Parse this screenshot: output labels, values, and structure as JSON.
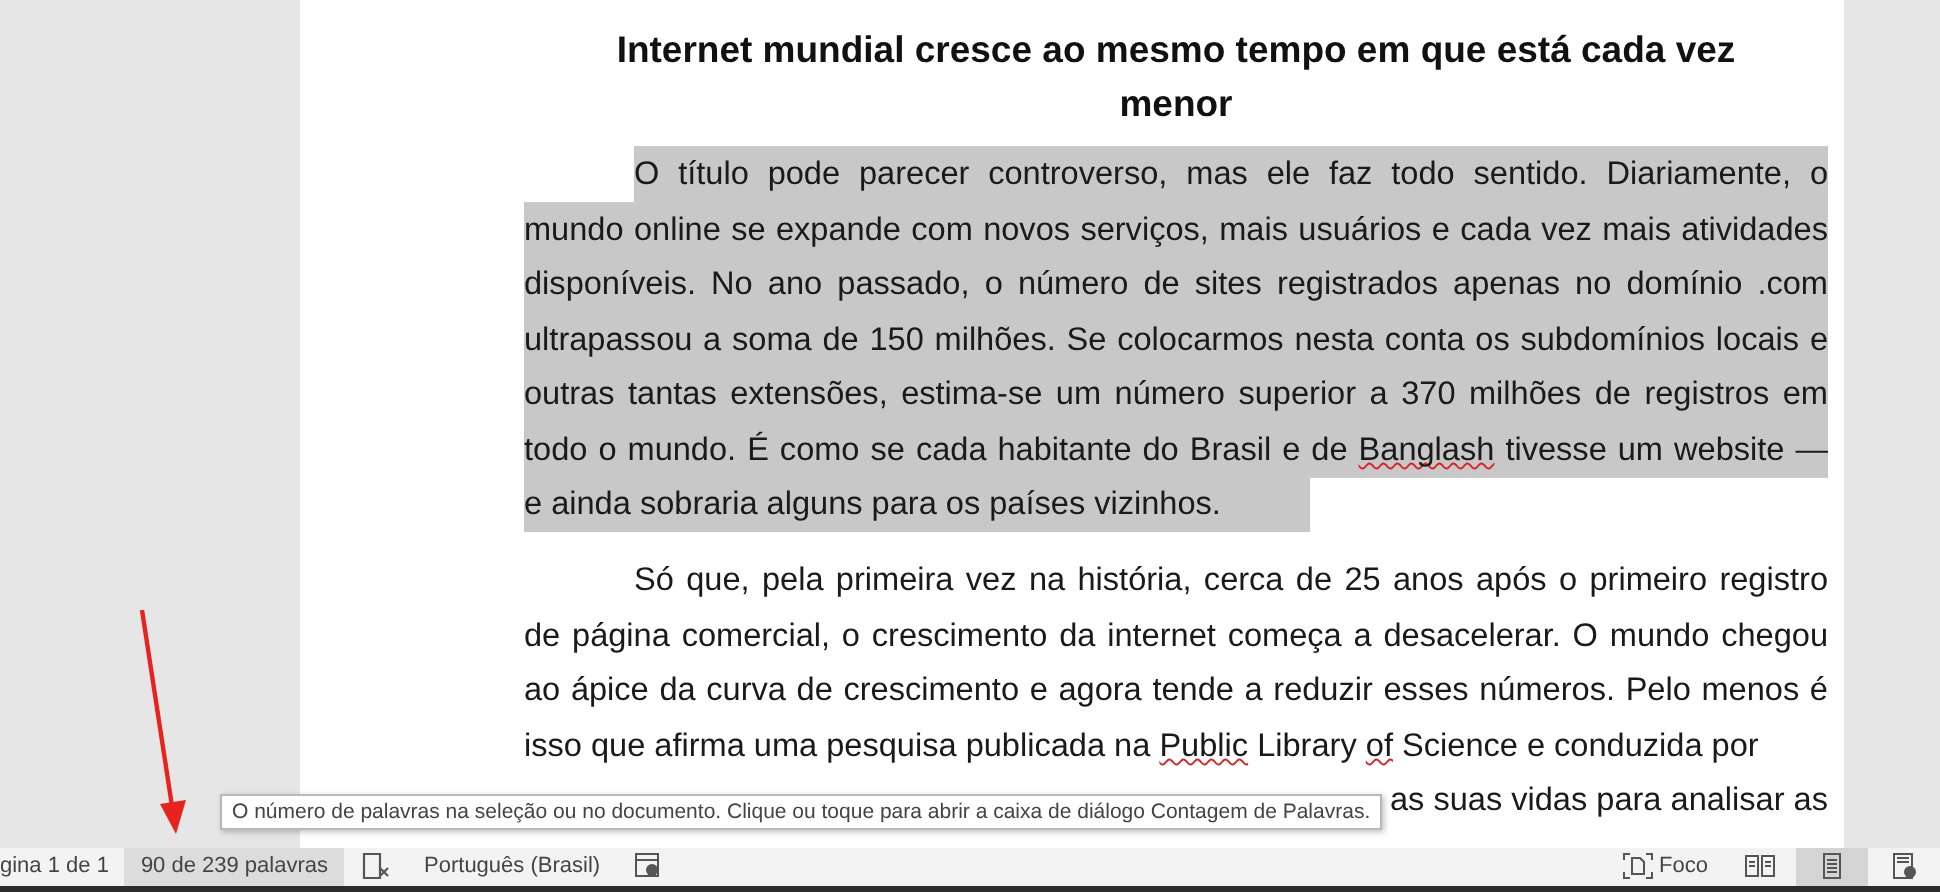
{
  "heading": "Internet mundial cresce ao mesmo tempo em que está cada vez menor",
  "paragraphs": [
    {
      "selected": true,
      "lines": [
        [
          {
            "text": "O título pode parecer controverso, mas ele faz todo sentido. Diariamente, o",
            "misspelled": false
          }
        ],
        [
          {
            "text": "mundo online se expande com novos serviços, mais usuários e cada vez mais atividades",
            "misspelled": false
          }
        ],
        [
          {
            "text": "disponíveis. No ano passado, o número de sites registrados apenas no domínio .com",
            "misspelled": false
          }
        ],
        [
          {
            "text": "ultrapassou a soma de 150 milhões. Se colocarmos nesta conta os subdomínios locais e",
            "misspelled": false
          }
        ],
        [
          {
            "text": "outras tantas extensões, estima-se um número superior a 370 milhões de registros em",
            "misspelled": false
          }
        ],
        [
          {
            "text": "todo o mundo. É como se cada habitante do Brasil e de",
            "misspelled": false
          },
          {
            "text": "Banglash",
            "misspelled": true
          },
          {
            "text": "tivesse um website —",
            "misspelled": false
          }
        ],
        [
          {
            "text": "e ainda sobraria alguns para os países vizinhos.",
            "misspelled": false
          }
        ]
      ]
    },
    {
      "selected": false,
      "lines": [
        [
          {
            "text": "Só que, pela primeira vez na história, cerca de 25 anos após o primeiro registro",
            "misspelled": false
          }
        ],
        [
          {
            "text": "de página comercial, o crescimento da internet começa a desacelerar. O mundo chegou",
            "misspelled": false
          }
        ],
        [
          {
            "text": "ao ápice da curva de crescimento e agora tende a reduzir esses números. Pelo menos é",
            "misspelled": false
          }
        ],
        [
          {
            "text": "isso que afirma uma pesquisa publicada na",
            "misspelled": false
          },
          {
            "text": "Public",
            "misspelled": true
          },
          {
            "text": "Library",
            "misspelled": false
          },
          {
            "text": "of",
            "misspelled": true
          },
          {
            "text": "Science e conduzida por",
            "misspelled": false
          }
        ]
      ]
    }
  ],
  "covered_line_fragment": "as suas vidas para analisar as",
  "tooltip": "O número de palavras na seleção ou no documento. Clique ou toque para abrir a caixa de diálogo Contagem de Palavras.",
  "status_bar": {
    "left": [
      {
        "kind": "text",
        "label": "gina 1 de 1",
        "hovered": false
      },
      {
        "kind": "text",
        "label": "90 de 239 palavras",
        "hovered": true
      },
      {
        "kind": "proofing"
      },
      {
        "kind": "text",
        "label": "Português (Brasil)",
        "hovered": false
      },
      {
        "kind": "accessibility"
      }
    ],
    "focus": {
      "label": "Foco"
    },
    "views": [
      {
        "kind": "read",
        "selected": false
      },
      {
        "kind": "print",
        "selected": true
      },
      {
        "kind": "web",
        "selected": false
      }
    ]
  }
}
